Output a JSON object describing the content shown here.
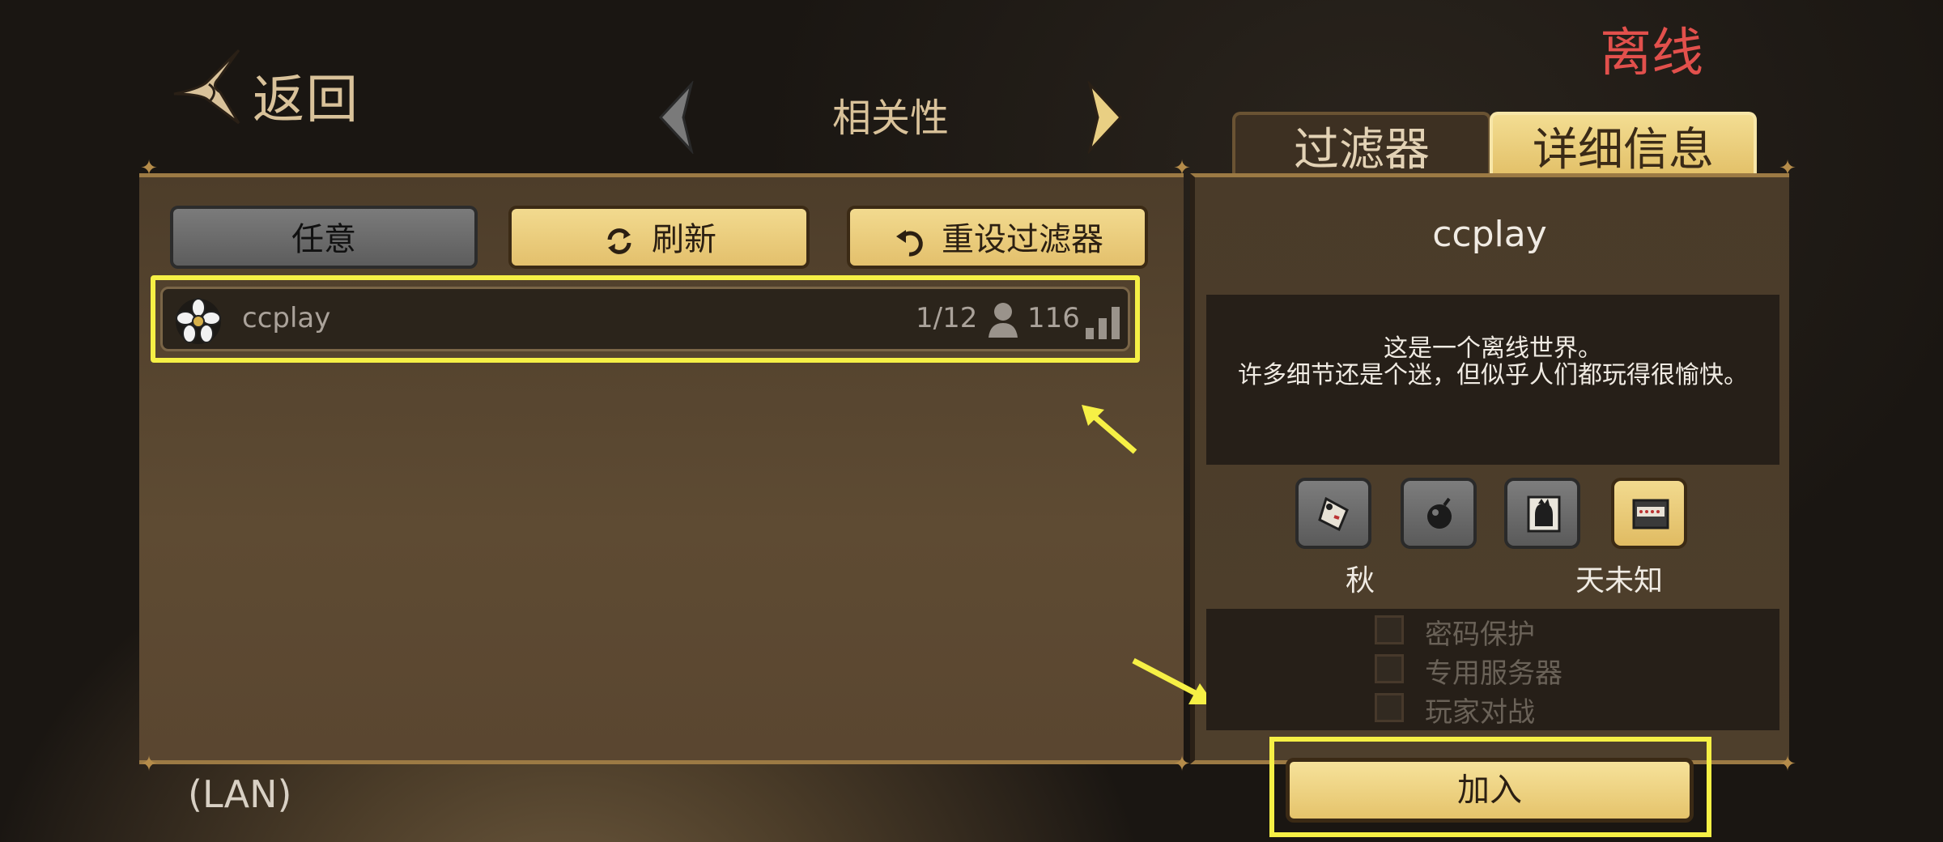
{
  "status": {
    "offline": "离线"
  },
  "header": {
    "back_label": "返回",
    "sort_label": "相关性"
  },
  "tabs": [
    {
      "label": "过滤器",
      "active": false
    },
    {
      "label": "详细信息",
      "active": true
    }
  ],
  "filter_buttons": {
    "any": "任意",
    "refresh": "刷新",
    "reset": "重设过滤器"
  },
  "servers": [
    {
      "name": "ccplay",
      "players": "1/12",
      "ping": "116"
    }
  ],
  "footer": {
    "network": "(LAN)"
  },
  "details": {
    "title": "ccplay",
    "description": "这是一个离线世界。\n许多细节还是个迷，但似乎人们都玩得很愉快。",
    "season": "秋",
    "day": "天未知",
    "options": [
      {
        "label": "密码保护",
        "checked": false
      },
      {
        "label": "专用服务器",
        "checked": false
      },
      {
        "label": "玩家对战",
        "checked": false
      }
    ],
    "join_label": "加入"
  },
  "colors": {
    "accent_gold": "#e5c36b",
    "highlight_yellow": "#f6f045",
    "offline_red": "#e2504c"
  }
}
